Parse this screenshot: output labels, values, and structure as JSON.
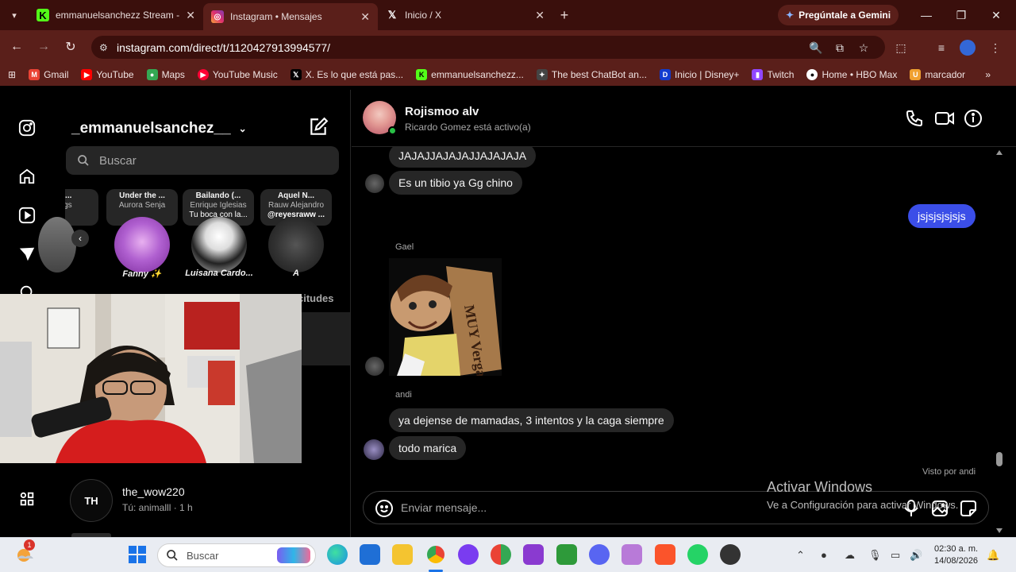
{
  "browser": {
    "tabs": [
      {
        "title": "emmanuelsanchezz Stream - W",
        "favicon": "kick-icon",
        "color": "#53fc18",
        "active": false
      },
      {
        "title": "Instagram • Mensajes",
        "favicon": "instagram-icon",
        "color": "#e1306c",
        "active": true
      },
      {
        "title": "Inicio / X",
        "favicon": "x-icon",
        "color": "#ffffff",
        "active": false
      }
    ],
    "gemini_label": "Pregúntale a Gemini",
    "url": "instagram.com/direct/t/1120427913994577/",
    "bookmarks": [
      {
        "label": "Gmail",
        "icon": "gmail-icon",
        "color": "#ea4335"
      },
      {
        "label": "YouTube",
        "icon": "youtube-icon",
        "color": "#ff0000"
      },
      {
        "label": "Maps",
        "icon": "maps-icon",
        "color": "#34a853"
      },
      {
        "label": "YouTube Music",
        "icon": "youtube-music-icon",
        "color": "#ff0033"
      },
      {
        "label": "X. Es lo que está pas...",
        "icon": "x-icon",
        "color": "#000000"
      },
      {
        "label": "emmanuelsanchezz...",
        "icon": "kick-icon",
        "color": "#53fc18"
      },
      {
        "label": "The best ChatBot an...",
        "icon": "chatbot-icon",
        "color": "#444444"
      },
      {
        "label": "Inicio | Disney+",
        "icon": "disney-icon",
        "color": "#113ccf"
      },
      {
        "label": "Twitch",
        "icon": "twitch-icon",
        "color": "#9146ff"
      },
      {
        "label": "Home • HBO Max",
        "icon": "hbo-icon",
        "color": "#222222"
      },
      {
        "label": "marcador",
        "icon": "bookmark-icon",
        "color": "#f0a030"
      }
    ]
  },
  "inbox": {
    "username": "_emmanuelsanchez__",
    "search_placeholder": "Buscar",
    "notes": [
      {
        "title": "am...",
        "sub": "Hags"
      },
      {
        "title": "Under the ...",
        "sub": "Aurora Senja"
      },
      {
        "title": "Bailando (...",
        "sub": "Enrique Iglesias",
        "sub2": "Tu boca con la..."
      },
      {
        "title": "Aquel N...",
        "sub": "Rauw Alejandro",
        "sub2": "@reyesraww ..."
      }
    ],
    "note_names": [
      "",
      "Fanny ✨",
      "Luisana Cardo...",
      "A"
    ],
    "requests_label": "citudes",
    "chat": {
      "name": "the_wow220",
      "preview": "Tú: animalll · 1 h",
      "avatar_text": "TH"
    }
  },
  "thread": {
    "name": "Rojismoo alv",
    "status": "Ricardo Gomez está activo(a)",
    "messages": [
      "JAJAJJAJAJAJJAJAJAJA",
      "Es un tibio ya Gg chino",
      "jsjsjsjsjsjs",
      "Gael",
      "ya dejense de mamadas, 3 intentos y la caga siempre",
      "todo marica",
      "andi"
    ],
    "sticker_text": "MUY Verga",
    "seen": "Visto por andi",
    "composer_placeholder": "Enviar mensaje..."
  },
  "watermark": {
    "line1": "Activar Windows",
    "line2": "Ve a Configuración para activar Windows."
  },
  "taskbar": {
    "search_placeholder": "Buscar",
    "notification_count": "1",
    "time": "02:30 a. m.",
    "date": "14/08/2026"
  }
}
